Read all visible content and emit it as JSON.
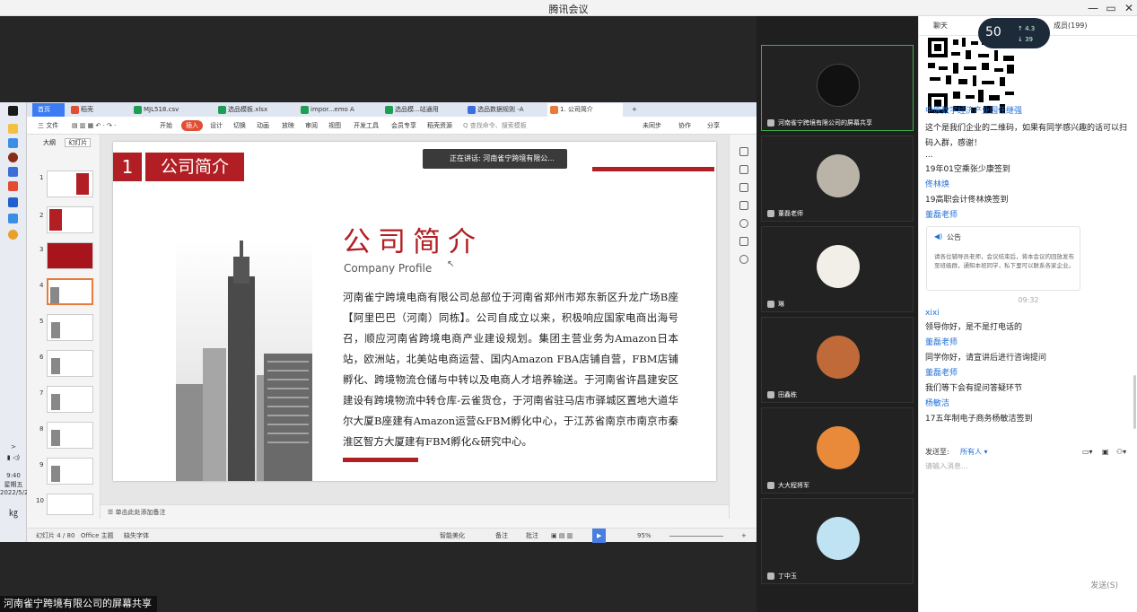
{
  "window": {
    "title": "腾讯会议",
    "min": "—",
    "max": "▭",
    "close": "✕"
  },
  "share": {
    "bottom_label": "河南雀宁跨境有限公司的屏幕共享",
    "speaker_tip": "正在讲话: 河南雀宁跨境有限公..."
  },
  "wps": {
    "tabs": [
      {
        "label": "首页",
        "color": "#3b7cf5"
      },
      {
        "label": "稻壳",
        "color": "#e24d33"
      },
      {
        "label": "MJL518.csv",
        "color": "#1e9e52"
      },
      {
        "label": "选品模板.xlsx",
        "color": "#1e9e52"
      },
      {
        "label": "impor...emo A",
        "color": "#1e9e52"
      },
      {
        "label": "选品模...站通用",
        "color": "#1e9e52"
      },
      {
        "label": "选品数据规则 -A",
        "color": "#3b6fe0"
      },
      {
        "label": "1. 公司简介",
        "color": "#e87a3c"
      }
    ],
    "menu": [
      "三 文件",
      "开始",
      "插入",
      "设计",
      "切换",
      "动画",
      "放映",
      "审阅",
      "视图",
      "开发工具",
      "会员专享",
      "稻壳资源",
      "Q 查找命令、搜索模板"
    ],
    "menu_right": [
      "未同步",
      "协作",
      "分享"
    ],
    "thumb_tabs": [
      "大纲",
      "幻灯片"
    ],
    "thumb_numbers": [
      "1",
      "2",
      "3",
      "4",
      "5",
      "6",
      "7",
      "8",
      "9",
      "10"
    ],
    "notes_placeholder": "单击此处添加备注",
    "status": {
      "slide_count": "幻灯片 4 / 80",
      "theme": "Office 主题",
      "font": "缺失字体",
      "smart": "智能美化",
      "notes": "备注",
      "comments": "批注",
      "zoom": "95%"
    },
    "left_clock": {
      "time": "9:40",
      "day": "星期五",
      "date": "2022/5/20"
    }
  },
  "slide": {
    "num": "1",
    "tag": "公司简介",
    "heading": "公司简介",
    "subtitle": "Company Profile",
    "body": "河南雀宁跨境电商有限公司总部位于河南省郑州市郑东新区升龙广场B座【阿里巴巴（河南）同栋】。公司自成立以来，积极响应国家电商出海号召，顺应河南省跨境电商产业建设规划。集团主营业务为Amazon日本站，欧洲站，北美站电商运营、国内Amazon FBA店铺自营，FBM店铺孵化、跨境物流仓储与中转以及电商人才培养输送。于河南省许昌建安区建设有跨境物流中转仓库-云雀货仓，于河南省驻马店市驿城区置地大道华尔大厦B座建有Amazon运营&FBM孵化中心，于江苏省南京市南京市秦淮区智方大厦建有FBM孵化&研究中心。"
  },
  "videos": [
    {
      "name": "河南雀宁跨境有限公司的屏幕共享",
      "color": "#111",
      "active": true
    },
    {
      "name": "董磊老师",
      "color": "#b9b3a8",
      "active": false
    },
    {
      "name": "琳",
      "color": "#f2efe9",
      "active": false
    },
    {
      "name": "田鑫栋",
      "color": "#c06a3a",
      "active": false
    },
    {
      "name": "大大程将军",
      "color": "#e98a3a",
      "active": false
    },
    {
      "name": "丁中玉",
      "color": "#bfe3f2",
      "active": false
    }
  ],
  "chat": {
    "header_left": "聊天",
    "header_right": "成员(199)",
    "network": {
      "pct": "50",
      "up": "4.3",
      "down": "39"
    },
    "messages": [
      {
        "kind": "name",
        "text": "中原数字经济产业园任继强"
      },
      {
        "kind": "msg",
        "text": "这个是我们企业的二维码，如果有同学感兴趣的话可以扫码入群，感谢！"
      },
      {
        "kind": "msg",
        "text": "..."
      },
      {
        "kind": "msg",
        "text": "19年01空乘张少康签到"
      },
      {
        "kind": "name",
        "text": "佟林焕"
      },
      {
        "kind": "msg",
        "text": "19高职会计佟林焕签到"
      },
      {
        "kind": "name",
        "text": "董磊老师"
      }
    ],
    "notice": {
      "title": "公告",
      "body": "请各位辅导员老师，会议结束后，将本会议的回放发布至班级群，通知本班同学，私下里可以联系各家企业。"
    },
    "time": "09:32",
    "messages2": [
      {
        "kind": "name",
        "text": "xixi"
      },
      {
        "kind": "msg",
        "text": "领导你好，是不是打电话的"
      },
      {
        "kind": "name",
        "text": "董磊老师"
      },
      {
        "kind": "msg",
        "text": "同学你好，请宣讲后进行咨询提问"
      },
      {
        "kind": "name",
        "text": "董磊老师"
      },
      {
        "kind": "msg",
        "text": "我们等下会有提问答疑环节"
      },
      {
        "kind": "name",
        "text": "杨敏洁"
      },
      {
        "kind": "msg",
        "text": "17五年制电子商务杨敏洁签到"
      }
    ],
    "send_to_label": "发送至:",
    "send_to_value": "所有人",
    "input_placeholder": "请输入消息...",
    "send_button": "发送(S)"
  }
}
